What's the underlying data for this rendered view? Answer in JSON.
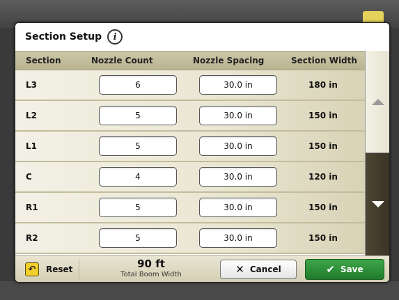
{
  "dialog": {
    "title": "Section Setup",
    "info_icon": "info-icon"
  },
  "table": {
    "headers": {
      "section": "Section",
      "nozzle_count": "Nozzle Count",
      "nozzle_spacing": "Nozzle Spacing",
      "section_width": "Section Width"
    },
    "rows": [
      {
        "section": "L3",
        "nozzle_count": "6",
        "nozzle_spacing": "30.0 in",
        "section_width": "180 in"
      },
      {
        "section": "L2",
        "nozzle_count": "5",
        "nozzle_spacing": "30.0 in",
        "section_width": "150 in"
      },
      {
        "section": "L1",
        "nozzle_count": "5",
        "nozzle_spacing": "30.0 in",
        "section_width": "150 in"
      },
      {
        "section": "C",
        "nozzle_count": "4",
        "nozzle_spacing": "30.0 in",
        "section_width": "120 in"
      },
      {
        "section": "R1",
        "nozzle_count": "5",
        "nozzle_spacing": "30.0 in",
        "section_width": "150 in"
      },
      {
        "section": "R2",
        "nozzle_count": "5",
        "nozzle_spacing": "30.0 in",
        "section_width": "150 in"
      }
    ]
  },
  "scrollbar": {
    "up_icon": "triangle-up-icon",
    "down_icon": "triangle-down-icon"
  },
  "footer": {
    "reset_label": "Reset",
    "reset_icon": "undo-icon",
    "total_value": "90 ft",
    "total_label": "Total Boom Width",
    "cancel_label": "Cancel",
    "cancel_icon": "x-icon",
    "save_label": "Save",
    "save_icon": "checkmark-icon"
  },
  "colors": {
    "header_bg": "#c4bfa0",
    "save_green": "#2e8f3a",
    "reset_yellow": "#f2cf2a"
  }
}
